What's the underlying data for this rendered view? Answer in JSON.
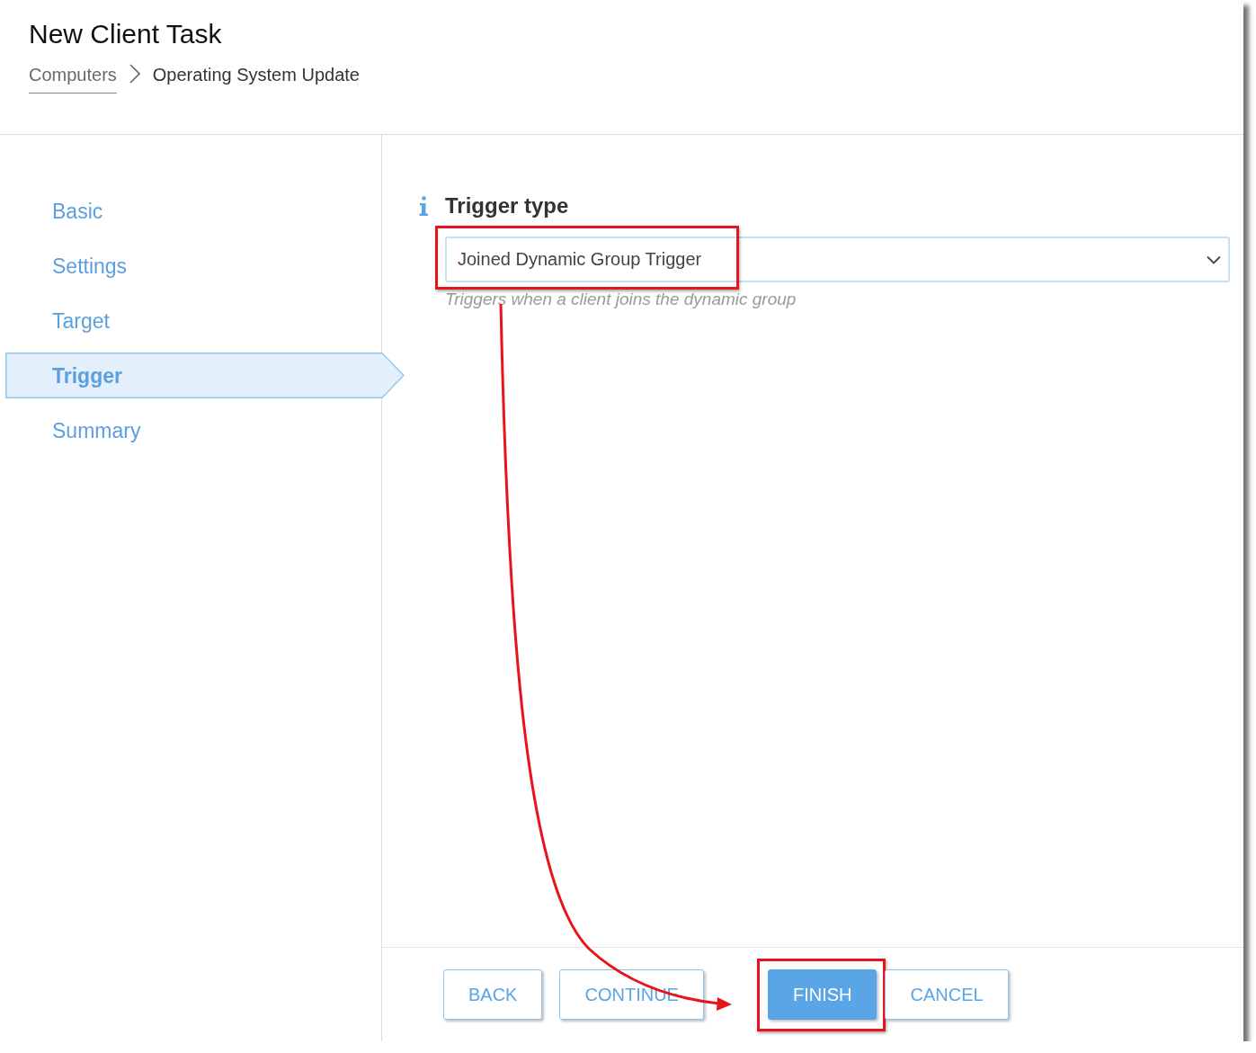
{
  "window": {
    "title": "New Client Task"
  },
  "breadcrumb": [
    {
      "label": "Computers",
      "kind": "link"
    },
    {
      "label": "Operating System Update",
      "kind": "current"
    }
  ],
  "steps": [
    {
      "label": "Basic",
      "selected": false
    },
    {
      "label": "Settings",
      "selected": false
    },
    {
      "label": "Target",
      "selected": false
    },
    {
      "label": "Trigger",
      "selected": true
    },
    {
      "label": "Summary",
      "selected": false
    }
  ],
  "trigger_type": {
    "label": "Trigger type",
    "value": "Joined Dynamic Group Trigger",
    "hint": "Triggers when a client joins the dynamic group",
    "highlighted": true
  },
  "buttons": [
    {
      "label": "BACK",
      "kind": "secondary",
      "highlighted": false
    },
    {
      "label": "CONTINUE",
      "kind": "secondary",
      "highlighted": false
    },
    {
      "label": "FINISH",
      "kind": "primary",
      "highlighted": true
    },
    {
      "label": "CANCEL",
      "kind": "secondary",
      "highlighted": false
    }
  ],
  "annotations": [
    {
      "kind": "curved-arrow"
    }
  ]
}
